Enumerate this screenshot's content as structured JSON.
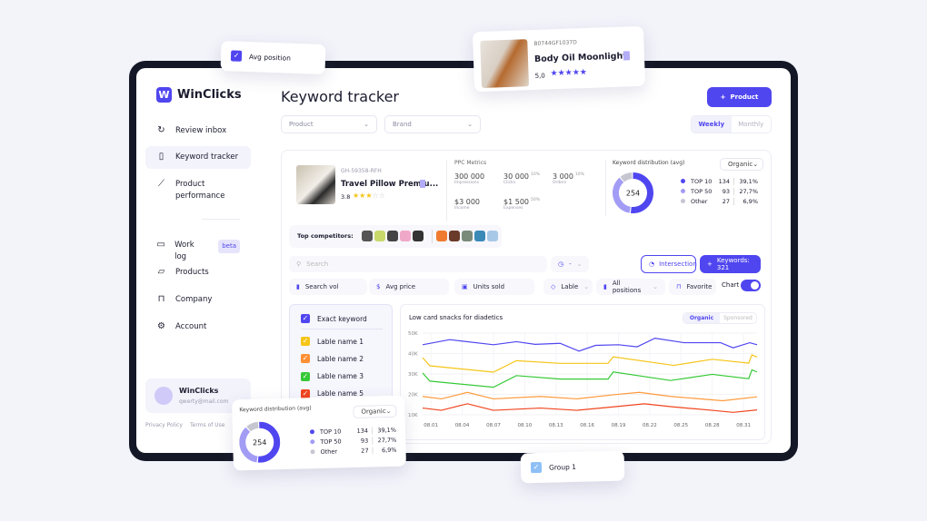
{
  "app": {
    "name": "WinClicks",
    "logo_letter": "W"
  },
  "sidebar": {
    "items": [
      {
        "label": "Review inbox",
        "icon": "refresh-icon"
      },
      {
        "label": "Keyword tracker",
        "icon": "book-icon",
        "active": true
      },
      {
        "label": "Product performance",
        "icon": "chart-line-icon"
      },
      {
        "label": "Work log",
        "icon": "file-icon",
        "badge": "beta"
      },
      {
        "label": "Products",
        "icon": "folder-icon"
      },
      {
        "label": "Company",
        "icon": "bookmark-icon"
      },
      {
        "label": "Account",
        "icon": "gear-icon"
      }
    ],
    "user": {
      "name": "WinClicks",
      "email": "qwerty@mail.com"
    },
    "footer": {
      "privacy": "Privacy Policy",
      "terms": "Terms of Use"
    }
  },
  "header": {
    "title": "Keyword tracker",
    "add_button": "Product",
    "filters": {
      "product": "Product",
      "brand": "Brand"
    },
    "period": {
      "weekly": "Weekly",
      "monthly": "Monthly",
      "selected": "Weekly"
    }
  },
  "product": {
    "sku": "GH-59358-RFH",
    "name": "Travel Pillow Premiu...",
    "rating": "3.8",
    "stars": 3
  },
  "ppc": {
    "title": "PPC Metrics",
    "metrics": [
      {
        "value": "300 000",
        "label": "Impressions",
        "delta": ""
      },
      {
        "value": "30 000",
        "label": "Clicks",
        "delta": "10%"
      },
      {
        "value": "3 000",
        "label": "Orders",
        "delta": "10%"
      },
      {
        "value": "$3 000",
        "label": "Income",
        "delta": ""
      },
      {
        "value": "$1 500",
        "label": "Expenses",
        "delta": "50%"
      }
    ]
  },
  "distribution": {
    "title": "Keyword distribution (avg)",
    "select": "Organic",
    "total": "254",
    "rows": [
      {
        "label": "TOP 10",
        "count": "134",
        "pct": "39,1%",
        "color": "#5046f0",
        "share": 134
      },
      {
        "label": "TOP 50",
        "count": "93",
        "pct": "27,7%",
        "color": "#a39cf5",
        "share": 93
      },
      {
        "label": "Other",
        "count": "27",
        "pct": "6,9%",
        "color": "#c5c6d0",
        "share": 27
      }
    ]
  },
  "competitors": {
    "label": "Top competitors:"
  },
  "toolbar": {
    "search_placeholder": "Search",
    "date_select": "-",
    "intersection": "Intersection",
    "keywords_button": "Keywords: 321",
    "filters": [
      "Search vol",
      "Avg price",
      "Units sold"
    ],
    "lable": "Lable",
    "positions": "All positions",
    "favorite": "Favorite",
    "chart_toggle": "Chart",
    "chart_on": true
  },
  "labels": {
    "exact": "Exact keyword",
    "items": [
      {
        "label": "Lable name 1",
        "color": "#f5c518"
      },
      {
        "label": "Lable name 2",
        "color": "#ff8f33"
      },
      {
        "label": "Lable name 3",
        "color": "#36c936"
      },
      {
        "label": "Lable name 5",
        "color": "#f0451e"
      }
    ]
  },
  "chart_data": {
    "type": "line",
    "title": "Low card snacks for diadetics",
    "tabs": [
      "Organic",
      "Sponsored"
    ],
    "selected_tab": "Organic",
    "yticks": [
      "50K",
      "40K",
      "30K",
      "20K",
      "10K"
    ],
    "ylim": [
      10,
      50
    ],
    "xlim": [
      0.2,
      32.3
    ],
    "xticks": [
      {
        "day": 1,
        "label": "08.01"
      },
      {
        "day": 4,
        "label": "08.04"
      },
      {
        "day": 7,
        "label": "08.07"
      },
      {
        "day": 10,
        "label": "08.10"
      },
      {
        "day": 13,
        "label": "08.13"
      },
      {
        "day": 16,
        "label": "08.16"
      },
      {
        "day": 19,
        "label": "08.19"
      },
      {
        "day": 22,
        "label": "08.22"
      },
      {
        "day": 25,
        "label": "08.25"
      },
      {
        "day": 28,
        "label": "08.28"
      },
      {
        "day": 31,
        "label": "08.31"
      }
    ],
    "series": [
      {
        "color": "#5046f0",
        "points": [
          [
            0.2,
            44.3
          ],
          [
            2.8,
            46.8
          ],
          [
            7,
            44.3
          ],
          [
            9.2,
            45.8
          ],
          [
            11,
            44.5
          ],
          [
            13.4,
            45
          ],
          [
            15.2,
            41.2
          ],
          [
            16.8,
            44
          ],
          [
            19,
            44.3
          ],
          [
            20.8,
            43.3
          ],
          [
            22.5,
            47.5
          ],
          [
            25.3,
            45.3
          ],
          [
            28.8,
            45.3
          ],
          [
            30,
            42.8
          ],
          [
            31.6,
            45.3
          ],
          [
            32.3,
            44.3
          ]
        ]
      },
      {
        "color": "#f5c518",
        "points": [
          [
            0.2,
            38
          ],
          [
            0.9,
            34
          ],
          [
            7,
            30.9
          ],
          [
            9.2,
            36.5
          ],
          [
            13.4,
            35.2
          ],
          [
            18,
            35.2
          ],
          [
            18.5,
            38.4
          ],
          [
            24.3,
            34.2
          ],
          [
            28,
            37.2
          ],
          [
            31.5,
            35.3
          ],
          [
            31.8,
            39.3
          ],
          [
            32.3,
            38.3
          ]
        ]
      },
      {
        "color": "#36c936",
        "points": [
          [
            0.2,
            30.5
          ],
          [
            0.9,
            26.5
          ],
          [
            7,
            23.5
          ],
          [
            9.2,
            29.2
          ],
          [
            13.4,
            27.5
          ],
          [
            18,
            27.5
          ],
          [
            18.5,
            31
          ],
          [
            24,
            26.8
          ],
          [
            28,
            29.8
          ],
          [
            31.5,
            27.7
          ],
          [
            31.8,
            32
          ],
          [
            32.3,
            31
          ]
        ]
      },
      {
        "color": "#ff9a3c",
        "points": [
          [
            0.2,
            19
          ],
          [
            2,
            17.8
          ],
          [
            4.5,
            21
          ],
          [
            7,
            17.8
          ],
          [
            11.5,
            19
          ],
          [
            15,
            17.8
          ],
          [
            18.5,
            19.8
          ],
          [
            21,
            21
          ],
          [
            24,
            19
          ],
          [
            29,
            16.9
          ],
          [
            32.3,
            18.8
          ]
        ]
      },
      {
        "color": "#f0451e",
        "points": [
          [
            0.2,
            13.3
          ],
          [
            2,
            12.2
          ],
          [
            4.5,
            15.4
          ],
          [
            7,
            12.2
          ],
          [
            11.5,
            13.3
          ],
          [
            15,
            12.2
          ],
          [
            18.5,
            13.9
          ],
          [
            21.5,
            15.4
          ],
          [
            24,
            14
          ],
          [
            28,
            12.2
          ],
          [
            30,
            11.2
          ],
          [
            32.3,
            12.4
          ]
        ]
      }
    ]
  },
  "floats": {
    "avg_position": "Avg position",
    "group": "Group 1",
    "product": {
      "sku": "B0744GF1037D",
      "name": "Body Oil Moonlight",
      "rating": "5,0",
      "stars": 5
    }
  },
  "colors": {
    "accent": "#5046f0",
    "background": "#f3f3fa",
    "frame": "#141826"
  }
}
